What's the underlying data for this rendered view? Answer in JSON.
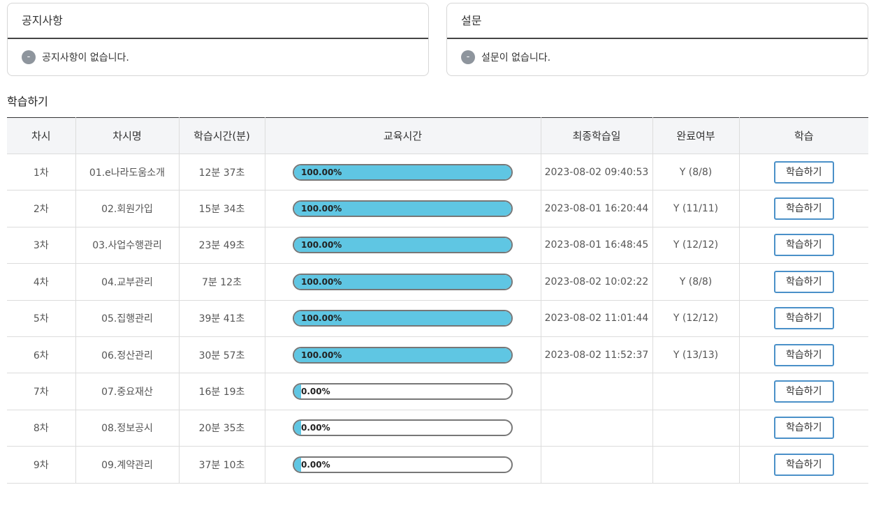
{
  "notice": {
    "title": "공지사항",
    "empty_text": "공지사항이 없습니다.",
    "icon": "minus-circle-icon",
    "icon_glyph": "-"
  },
  "survey": {
    "title": "설문",
    "empty_text": "설문이 없습니다.",
    "icon": "minus-circle-icon",
    "icon_glyph": "-"
  },
  "learning": {
    "title": "학습하기",
    "columns": [
      "차시",
      "차시명",
      "학습시간(분)",
      "교육시간",
      "최종학습일",
      "완료여부",
      "학습"
    ],
    "button_label": "학습하기",
    "progress_color": "#5fc6e3",
    "rows": [
      {
        "session": "1차",
        "name": "01.e나라도움소개",
        "duration": "12분 37초",
        "progress": 100,
        "progress_text": "100.00%",
        "last_date": "2023-08-02 09:40:53",
        "complete": "Y (8/8)"
      },
      {
        "session": "2차",
        "name": "02.회원가입",
        "duration": "15분 34초",
        "progress": 100,
        "progress_text": "100.00%",
        "last_date": "2023-08-01 16:20:44",
        "complete": "Y (11/11)"
      },
      {
        "session": "3차",
        "name": "03.사업수행관리",
        "duration": "23분 49초",
        "progress": 100,
        "progress_text": "100.00%",
        "last_date": "2023-08-01 16:48:45",
        "complete": "Y (12/12)"
      },
      {
        "session": "4차",
        "name": "04.교부관리",
        "duration": "7분 12초",
        "progress": 100,
        "progress_text": "100.00%",
        "last_date": "2023-08-02 10:02:22",
        "complete": "Y (8/8)"
      },
      {
        "session": "5차",
        "name": "05.집행관리",
        "duration": "39분 41초",
        "progress": 100,
        "progress_text": "100.00%",
        "last_date": "2023-08-02 11:01:44",
        "complete": "Y (12/12)"
      },
      {
        "session": "6차",
        "name": "06.정산관리",
        "duration": "30분 57초",
        "progress": 100,
        "progress_text": "100.00%",
        "last_date": "2023-08-02 11:52:37",
        "complete": "Y (13/13)"
      },
      {
        "session": "7차",
        "name": "07.중요재산",
        "duration": "16분 19초",
        "progress": 0,
        "progress_text": "0.00%",
        "last_date": "",
        "complete": ""
      },
      {
        "session": "8차",
        "name": "08.정보공시",
        "duration": "20분 35초",
        "progress": 0,
        "progress_text": "0.00%",
        "last_date": "",
        "complete": ""
      },
      {
        "session": "9차",
        "name": "09.계약관리",
        "duration": "37분 10초",
        "progress": 0,
        "progress_text": "0.00%",
        "last_date": "",
        "complete": ""
      }
    ]
  }
}
